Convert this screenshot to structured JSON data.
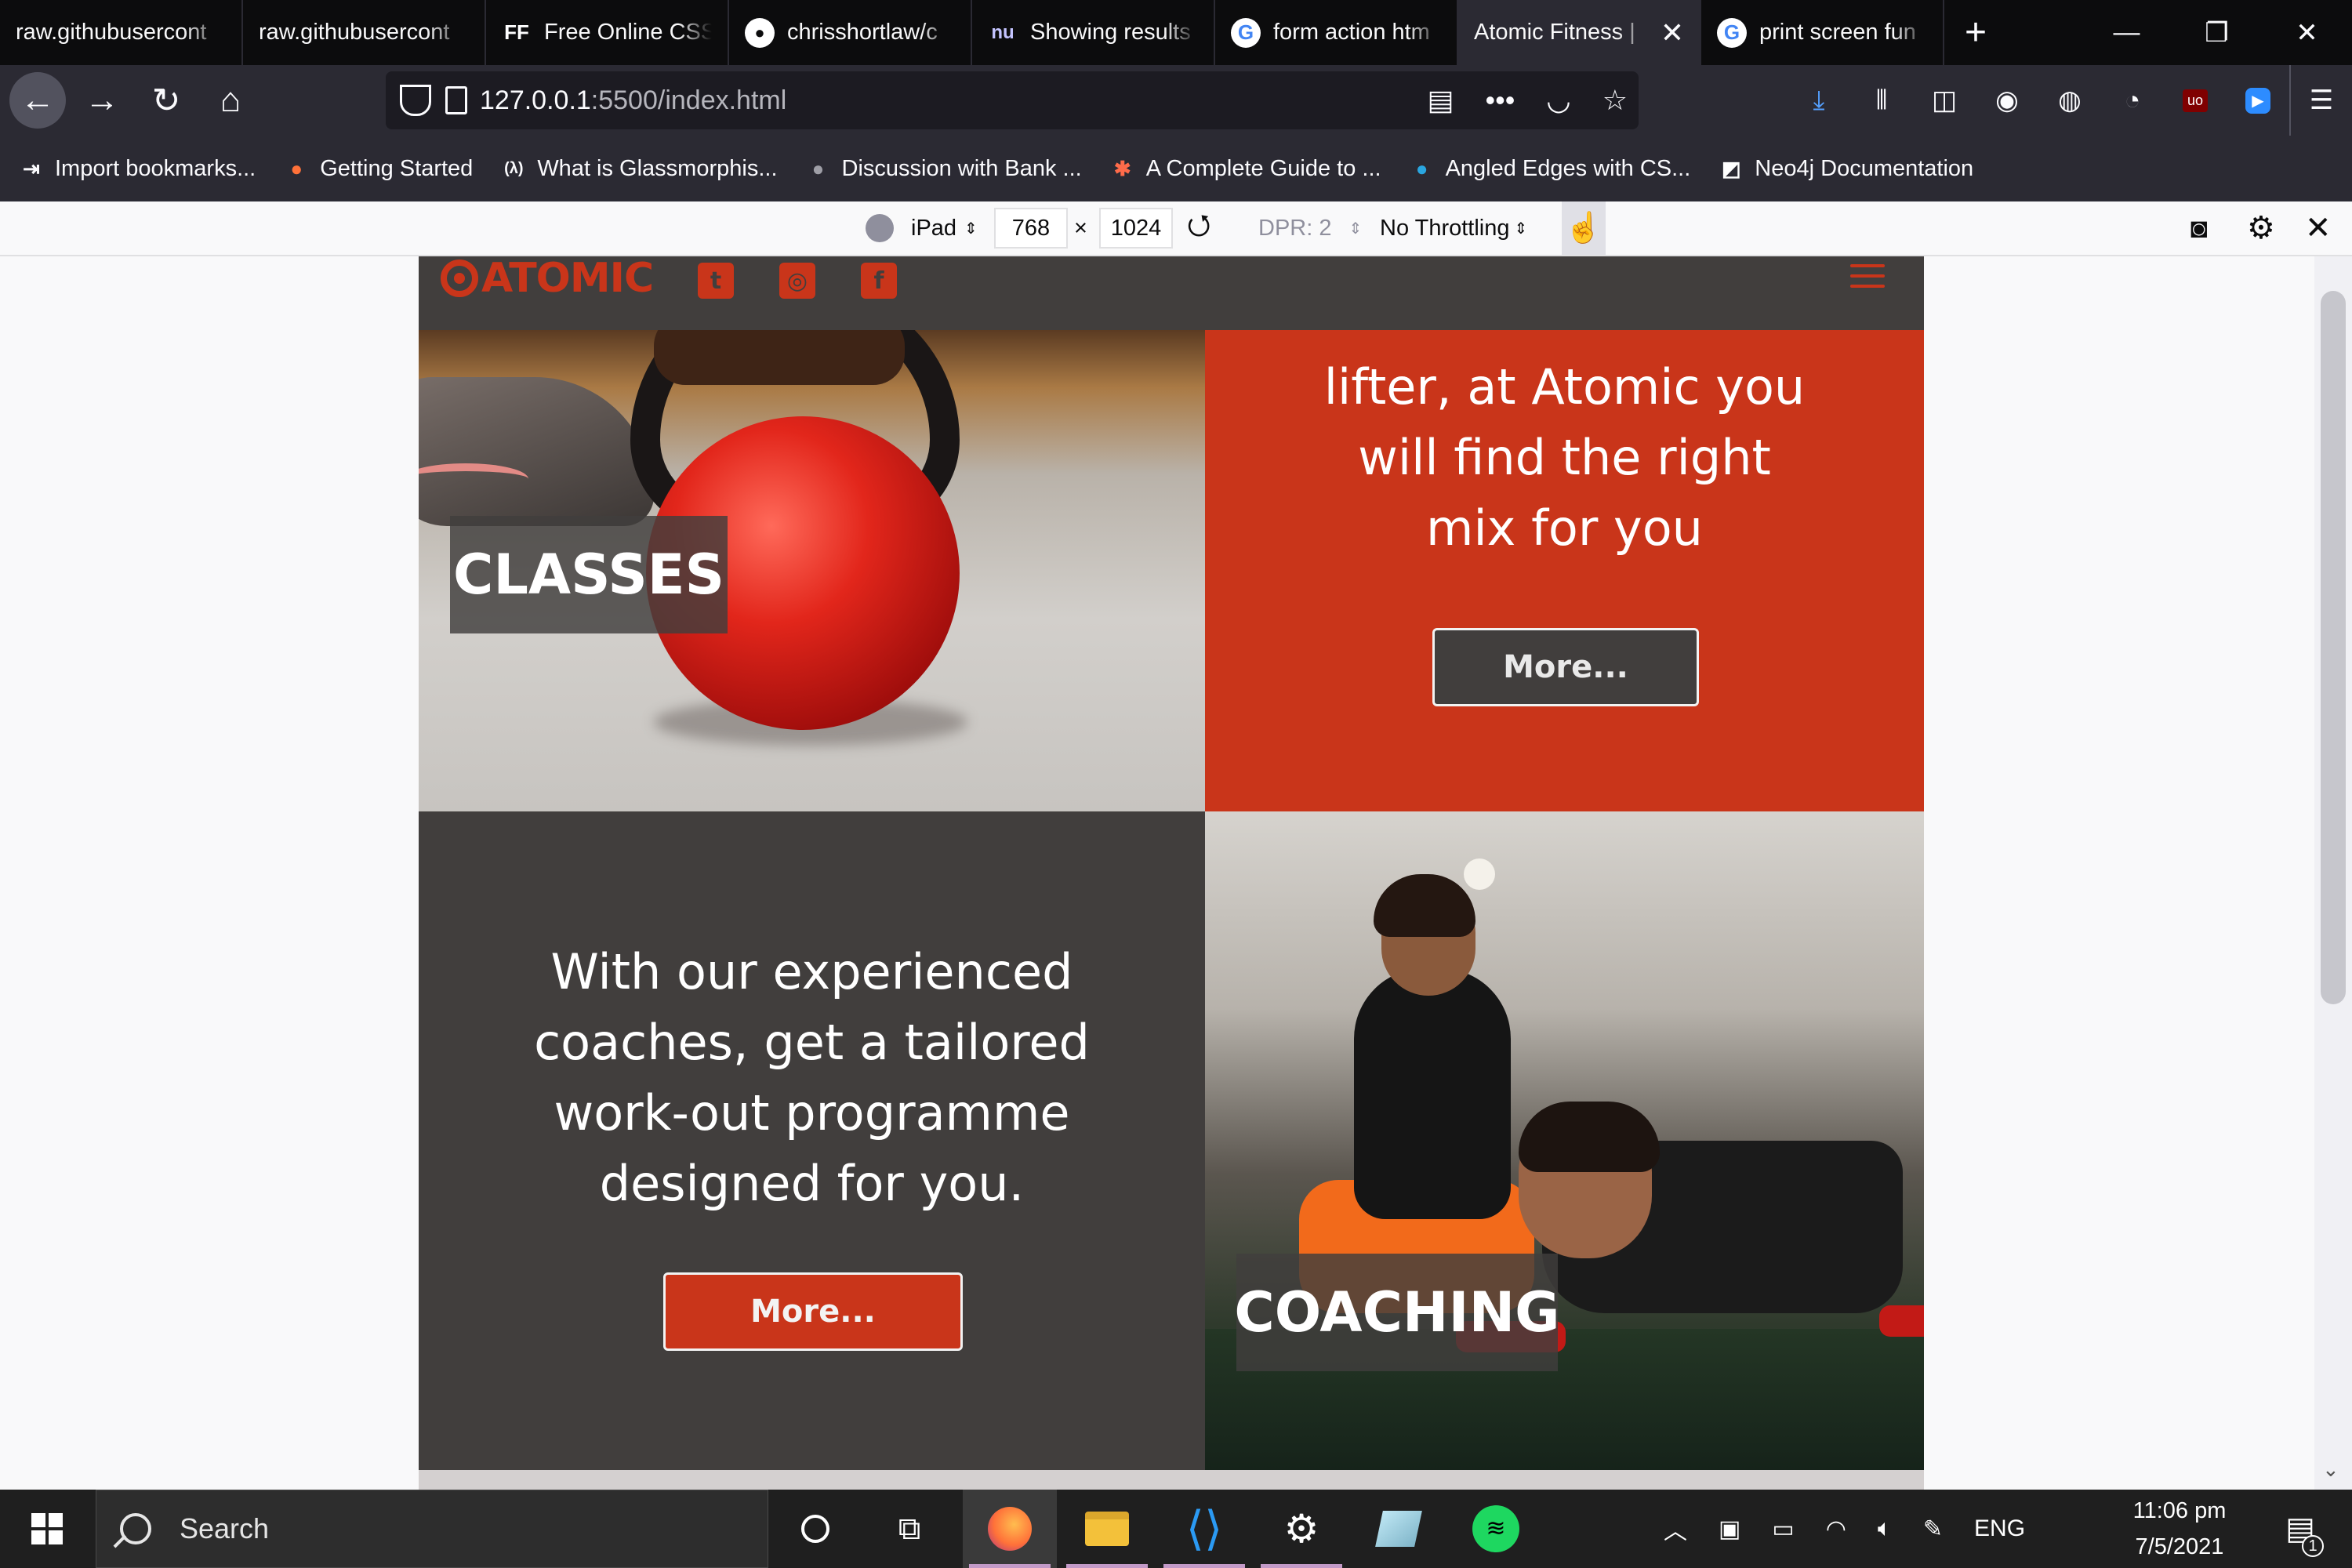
{
  "browser": {
    "tabs": [
      {
        "title": "raw.githubusercont",
        "icon": "none"
      },
      {
        "title": "raw.githubusercont",
        "icon": "none"
      },
      {
        "title": "Free Online CSS",
        "icon": "ff-logo-icon",
        "glyph": "FF"
      },
      {
        "title": "chrisshortlaw/c",
        "icon": "github-icon",
        "glyph": "●"
      },
      {
        "title": "Showing results",
        "icon": "nu-icon",
        "glyph": "nu"
      },
      {
        "title": "form action htm",
        "icon": "google-icon",
        "glyph": "G"
      },
      {
        "title": "Atomic Fitness |",
        "icon": "none",
        "active": true
      },
      {
        "title": "print screen fun",
        "icon": "google-icon",
        "glyph": "G"
      }
    ],
    "new_tab_glyph": "+",
    "window_controls": [
      "—",
      "❐",
      "✕"
    ],
    "url": {
      "host": "127.0.0.1",
      "path": ":5500/index.html"
    },
    "bookmarks": [
      {
        "label": "Import bookmarks...",
        "icon": "import-icon",
        "glyph": "⇥"
      },
      {
        "label": "Getting Started",
        "icon": "firefox-icon",
        "glyph": "●"
      },
      {
        "label": "What is Glassmorphis...",
        "icon": "freecodecamp-icon",
        "glyph": "(λ)"
      },
      {
        "label": "Discussion with Bank ...",
        "icon": "discussion-icon",
        "glyph": "●"
      },
      {
        "label": "A Complete Guide to ...",
        "icon": "asterisk-icon",
        "glyph": "✱"
      },
      {
        "label": "Angled Edges with CS...",
        "icon": "dots-icon",
        "glyph": "●"
      },
      {
        "label": "Neo4j Documentation",
        "icon": "neo4j-icon",
        "glyph": "◩"
      }
    ]
  },
  "responsive_toolbar": {
    "device": "iPad",
    "width": "768",
    "times": "×",
    "height": "1024",
    "dpr": "DPR: 2",
    "throttling": "No Throttling"
  },
  "site": {
    "brand": "ATOMIC",
    "social": [
      {
        "name": "twitter",
        "glyph": "t"
      },
      {
        "name": "instagram",
        "glyph": "◎"
      },
      {
        "name": "facebook",
        "glyph": "f"
      }
    ],
    "classes_label": "CLASSES",
    "red_panel_lines": [
      "lifter, at Atomic you",
      "will find the right",
      "mix for you"
    ],
    "red_panel_button": "More...",
    "coaching_text_lines": [
      "With our experienced",
      "coaches, get a tailored",
      "work-out programme",
      "designed for you."
    ],
    "coaching_button": "More...",
    "coaching_label": "COACHING",
    "colors": {
      "accent": "#c9351a",
      "dark": "#413e3d"
    }
  },
  "taskbar": {
    "search_placeholder": "Search",
    "apps": [
      "cortana",
      "task-view",
      "firefox",
      "file-explorer",
      "vscode",
      "settings",
      "notes",
      "spotify"
    ],
    "language": "ENG",
    "time": "11:06 pm",
    "date": "7/5/2021",
    "notification_count": "1"
  }
}
